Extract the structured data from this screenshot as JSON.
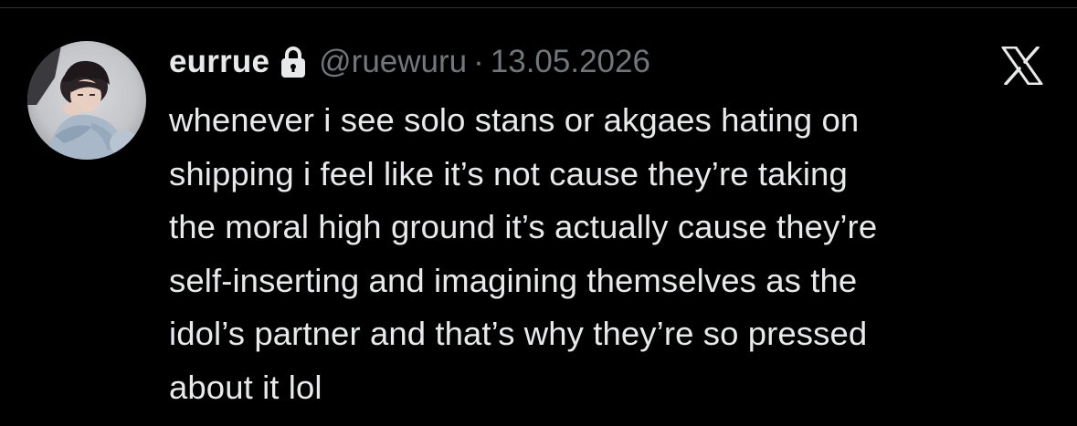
{
  "tweet": {
    "display_name": "eurrue",
    "handle": "@ruewuru",
    "separator": "·",
    "date": "13.05.2026",
    "protected_icon": "lock-icon",
    "platform_icon": "x-logo-icon",
    "avatar": "user-avatar",
    "text_lines": [
      "whenever i see solo stans or akgaes hating on",
      "shipping i feel like it’s not cause they’re taking",
      "the moral high ground it’s actually cause they’re",
      "self-inserting and imagining themselves as the",
      "idol’s partner and that’s why they’re so pressed",
      "about it lol"
    ]
  },
  "colors": {
    "background": "#000000",
    "primary_text": "#e7e9ea",
    "secondary_text": "#71767b"
  }
}
